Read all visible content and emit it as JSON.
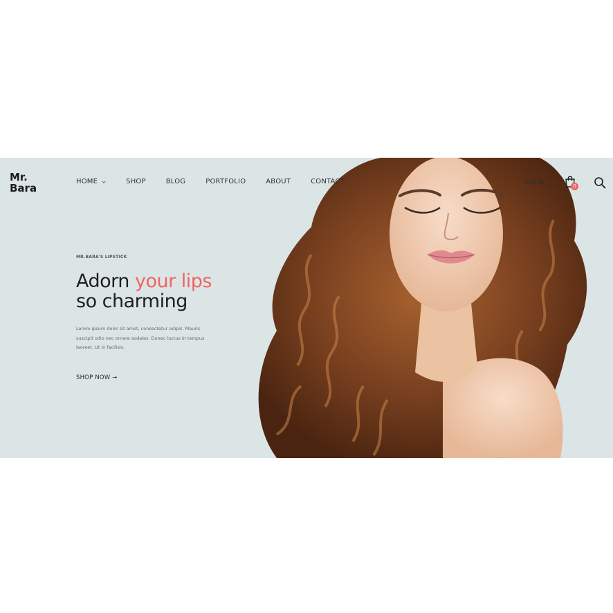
{
  "brand": {
    "logo_line1": "Mr.",
    "logo_line2": "Bara"
  },
  "nav": {
    "items": [
      {
        "label": "HOME",
        "has_dropdown": true
      },
      {
        "label": "SHOP"
      },
      {
        "label": "BLOG"
      },
      {
        "label": "PORTFOLIO"
      },
      {
        "label": "ABOUT"
      },
      {
        "label": "CONTACT"
      }
    ]
  },
  "header": {
    "login_label": "LOG IN",
    "cart_count": "0",
    "cart_icon": "shopping-bag-icon",
    "search_icon": "search-icon"
  },
  "hero": {
    "eyebrow": "MR.BARA'S LIPSTICK",
    "headline_part1": "Adorn ",
    "headline_accent": "your lips",
    "headline_line2": "so charming",
    "body": "Lorem ipsum dolor sit amet, consectetur adipis. Mauris suscipit odio nec ornare sodales. Donec luctus in tempus laoreet. Ut in facilisis.",
    "cta_label": "SHOP NOW →"
  },
  "colors": {
    "accent": "#f06464",
    "hero_bg": "#dce5e6",
    "text": "#1f1f1f"
  }
}
